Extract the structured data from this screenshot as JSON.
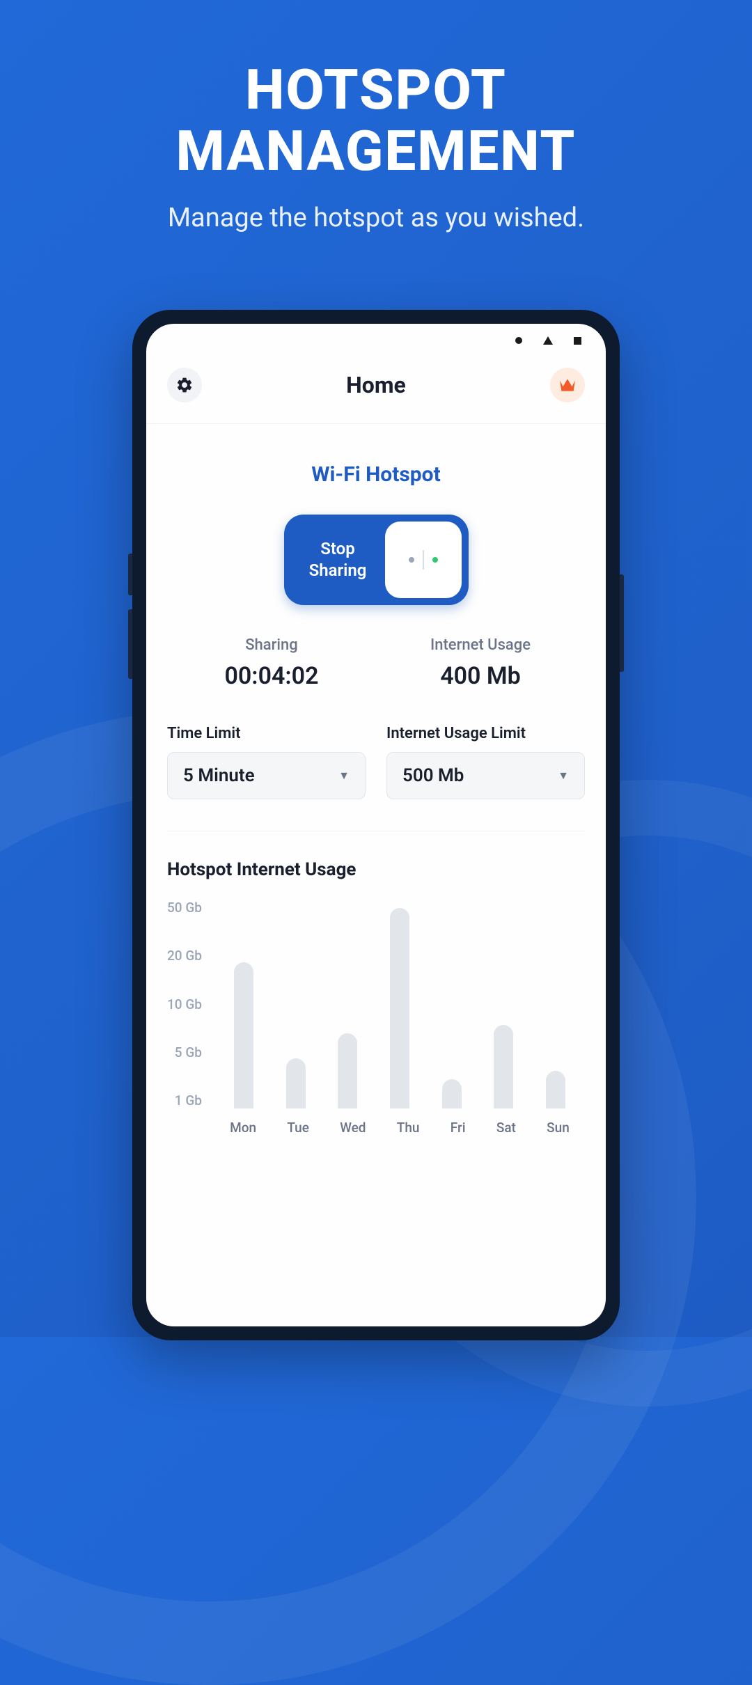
{
  "promo": {
    "title_line1": "HOTSPOT",
    "title_line2": "MANAGEMENT",
    "subtitle": "Manage the hotspot as you wished."
  },
  "header": {
    "title": "Home"
  },
  "hotspot": {
    "section_title": "Wi-Fi Hotspot",
    "toggle_label": "Stop\nSharing"
  },
  "stats": {
    "sharing_label": "Sharing",
    "sharing_value": "00:04:02",
    "usage_label": "Internet Usage",
    "usage_value": "400 Mb"
  },
  "limits": {
    "time_label": "Time Limit",
    "time_value": "5 Minute",
    "usage_label": "Internet Usage Limit",
    "usage_value": "500 Mb"
  },
  "chart_data": {
    "type": "bar",
    "title": "Hotspot Internet Usage",
    "categories": [
      "Mon",
      "Tue",
      "Wed",
      "Thu",
      "Fri",
      "Sat",
      "Sun"
    ],
    "values": [
      35,
      12,
      18,
      48,
      7,
      20,
      9
    ],
    "ylabel": "",
    "xlabel": "",
    "y_ticks": [
      "50 Gb",
      "20 Gb",
      "10 Gb",
      "5 Gb",
      "1 Gb"
    ],
    "ylim": [
      0,
      50
    ]
  },
  "colors": {
    "primary": "#1e5cc4",
    "accent": "#f15a29"
  }
}
